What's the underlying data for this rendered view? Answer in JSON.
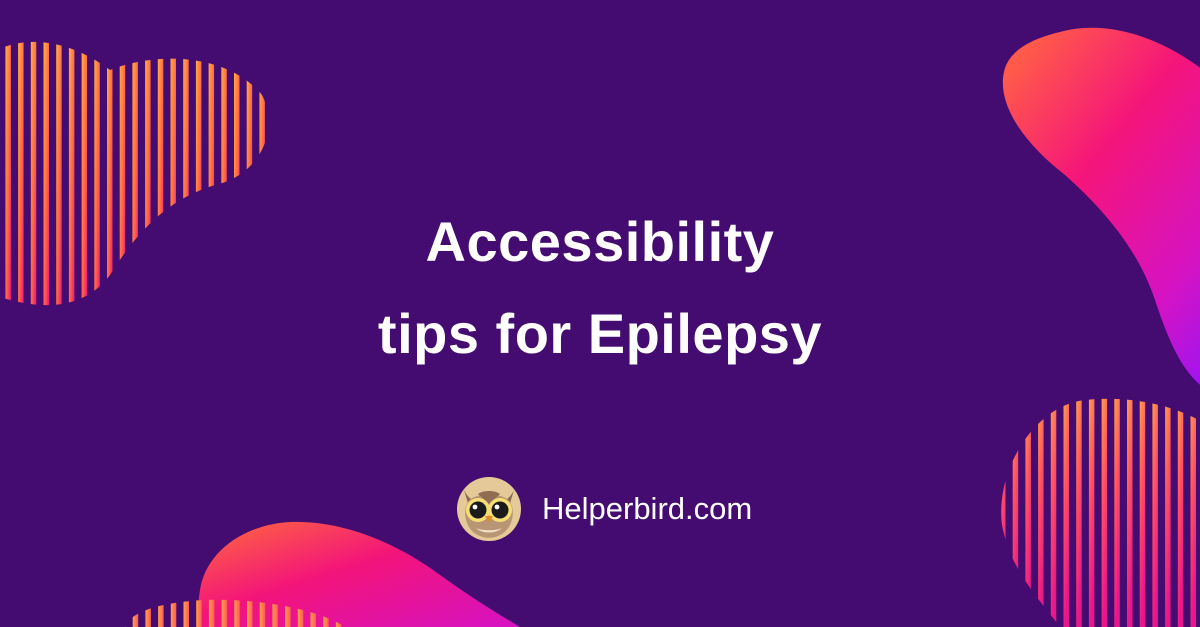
{
  "headline": {
    "line1": "Accessibility",
    "line2": "tips for Epilepsy"
  },
  "brand": {
    "name": "Helperbird.com",
    "logo_icon": "owl-logo-icon"
  },
  "colors": {
    "background": "#440b70",
    "gradient_warm": "#ff7a3d",
    "gradient_pink": "#f0137a",
    "gradient_magenta": "#d112c9",
    "gradient_violet": "#9b14f2",
    "text": "#ffffff"
  }
}
